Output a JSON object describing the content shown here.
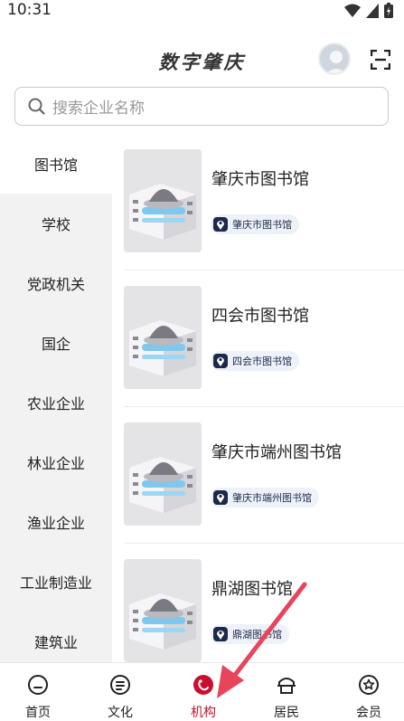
{
  "status_bar": {
    "time": "10:31"
  },
  "header": {
    "title": "数字肇庆"
  },
  "search": {
    "placeholder": "搜索企业名称"
  },
  "sidebar": {
    "items": [
      {
        "label": "图书馆",
        "active": true
      },
      {
        "label": "学校"
      },
      {
        "label": "党政机关"
      },
      {
        "label": "国企"
      },
      {
        "label": "农业企业"
      },
      {
        "label": "林业企业"
      },
      {
        "label": "渔业企业"
      },
      {
        "label": "工业制造业"
      },
      {
        "label": "建筑业"
      }
    ]
  },
  "list": {
    "items": [
      {
        "name": "肇庆市图书馆",
        "tag": "肇庆市图书馆"
      },
      {
        "name": "四会市图书馆",
        "tag": "四会市图书馆"
      },
      {
        "name": "肇庆市端州图书馆",
        "tag": "肇庆市端州图书馆"
      },
      {
        "name": "鼎湖图书馆",
        "tag": "鼎湖图书馆"
      }
    ]
  },
  "tabbar": {
    "tabs": [
      {
        "label": "首页",
        "icon": "home-icon"
      },
      {
        "label": "文化",
        "icon": "culture-icon"
      },
      {
        "label": "机构",
        "icon": "organization-icon",
        "active": true
      },
      {
        "label": "居民",
        "icon": "resident-icon"
      },
      {
        "label": "会员",
        "icon": "member-icon"
      }
    ]
  },
  "colors": {
    "accent": "#c8102e",
    "arrow": "#e8445c",
    "tag_bg": "#eef1f8",
    "tag_text": "#1c2a4a"
  }
}
